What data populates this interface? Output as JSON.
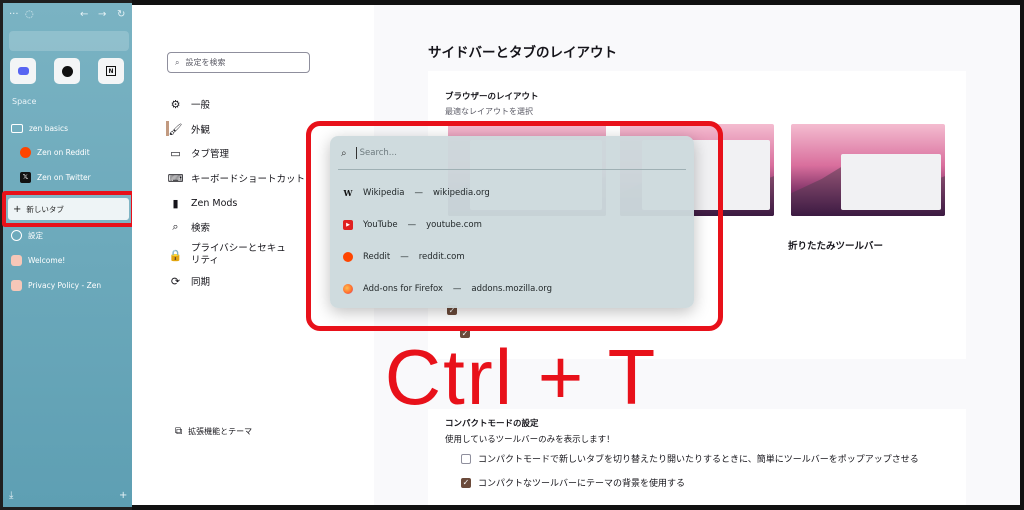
{
  "sidebar": {
    "space_label": "Space",
    "workspace": "zen basics",
    "tabs": [
      {
        "label": "Zen on Reddit",
        "icon": "reddit-icon"
      },
      {
        "label": "Zen on Twitter",
        "icon": "x-twitter-icon"
      }
    ],
    "new_tab_label": "新しいタブ",
    "items_below": [
      {
        "label": "設定",
        "icon": "gear-icon"
      },
      {
        "label": "Welcome!",
        "icon": "zen-icon"
      },
      {
        "label": "Privacy Policy - Zen",
        "icon": "zen-icon"
      }
    ]
  },
  "settings": {
    "search_placeholder": "設定を検索",
    "nav": [
      {
        "label": "一般",
        "icon": "gear-icon"
      },
      {
        "label": "外観",
        "icon": "paintbrush-icon",
        "active": true
      },
      {
        "label": "タブ管理",
        "icon": "tabs-icon"
      },
      {
        "label": "キーボードショートカット",
        "icon": "keyboard-icon"
      },
      {
        "label": "Zen Mods",
        "icon": "brush-icon"
      },
      {
        "label": "検索",
        "icon": "search-icon"
      },
      {
        "label": "プライバシーとセキュリティ",
        "icon": "lock-icon"
      },
      {
        "label": "同期",
        "icon": "sync-icon"
      }
    ],
    "extensions_link": "拡張機能とテーマ",
    "page_title": "サイドバーとタブのレイアウト",
    "layout_card": {
      "heading": "ブラウザーのレイアウト",
      "subheading": "最適なレイアウトを選択",
      "collapsed_toolbar_label": "折りたたみツールバー"
    },
    "compact_card": {
      "heading_partial": "コンパクトモードの設定",
      "description": "使用しているツールバーのみを表示します！",
      "options": [
        {
          "label": "コンパクトモードで新しいタブを切り替えたり開いたりするときに、簡単にツールバーをポップアップさせる",
          "checked": false
        },
        {
          "label": "コンパクトなツールバーにテーマの背景を使用する",
          "checked": true
        }
      ]
    }
  },
  "popup": {
    "placeholder": "Search...",
    "suggestions": [
      {
        "name": "Wikipedia",
        "domain": "wikipedia.org",
        "icon": "wikipedia-icon"
      },
      {
        "name": "YouTube",
        "domain": "youtube.com",
        "icon": "youtube-icon"
      },
      {
        "name": "Reddit",
        "domain": "reddit.com",
        "icon": "reddit-icon"
      },
      {
        "name": "Add-ons for Firefox",
        "domain": "addons.mozilla.org",
        "icon": "firefox-icon"
      }
    ]
  },
  "annotation": {
    "shortcut": "Ctrl + T",
    "color": "#e8111a"
  }
}
